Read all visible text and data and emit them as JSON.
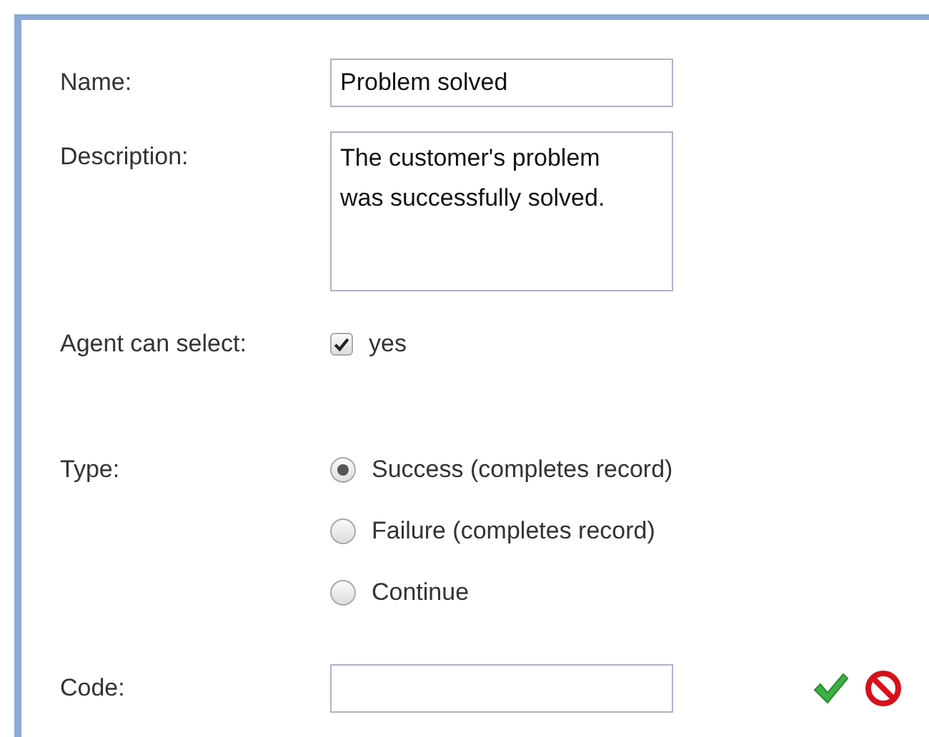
{
  "form": {
    "fields": [
      {
        "kind": "text",
        "label": "Name:",
        "value": "Problem solved"
      },
      {
        "kind": "textarea",
        "label": "Description:",
        "value": "The customer's problem\nwas successfully solved."
      },
      {
        "kind": "checkbox",
        "label": "Agent can select:",
        "option": "yes",
        "checked": true
      },
      {
        "kind": "radio",
        "label": "Type:",
        "options": [
          {
            "label": "Success (completes record)",
            "selected": true
          },
          {
            "label": "Failure (completes record)",
            "selected": false
          },
          {
            "label": "Continue",
            "selected": false
          }
        ]
      },
      {
        "kind": "editable",
        "label": "Code:"
      }
    ]
  }
}
